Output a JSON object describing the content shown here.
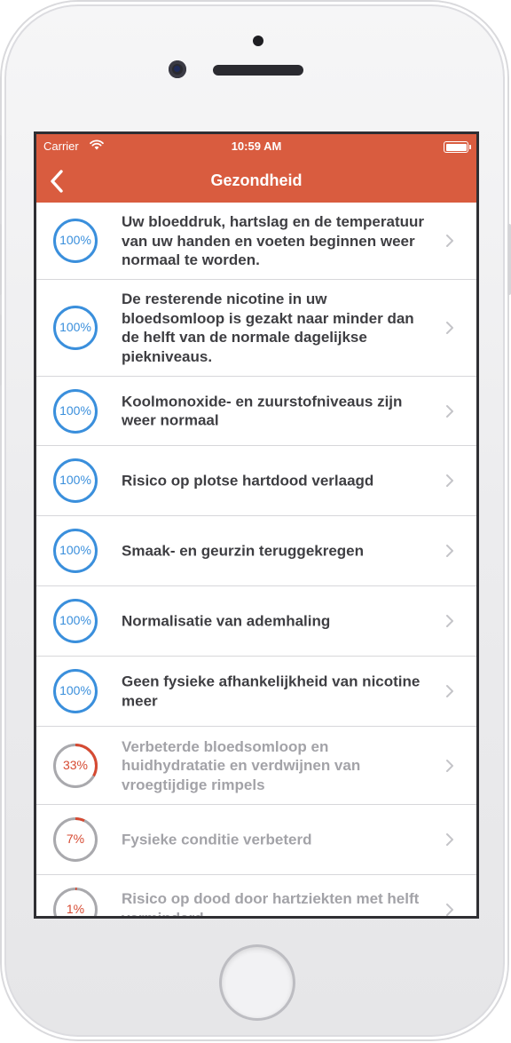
{
  "status_bar": {
    "carrier": "Carrier",
    "time": "10:59 AM"
  },
  "nav": {
    "title": "Gezondheid",
    "back_icon": "chevron-left-icon"
  },
  "colors": {
    "header": "#d95c3f",
    "ring_complete": "#3a8fdc",
    "ring_progress": "#d64a32",
    "ring_track": "#a9a9ad"
  },
  "items": [
    {
      "percent_label": "100%",
      "progress": 1.0,
      "text": "Uw bloeddruk, hartslag en de temperatuur van uw handen en voeten beginnen weer normaal te worden."
    },
    {
      "percent_label": "100%",
      "progress": 1.0,
      "text": "De resterende nicotine in uw bloedsomloop is gezakt naar minder dan de helft van de normale dagelijkse piekniveaus."
    },
    {
      "percent_label": "100%",
      "progress": 1.0,
      "text": "Koolmonoxide- en zuurstofniveaus zijn weer normaal"
    },
    {
      "percent_label": "100%",
      "progress": 1.0,
      "text": "Risico op plotse hartdood verlaagd"
    },
    {
      "percent_label": "100%",
      "progress": 1.0,
      "text": "Smaak- en geurzin teruggekregen"
    },
    {
      "percent_label": "100%",
      "progress": 1.0,
      "text": "Normalisatie van ademhaling"
    },
    {
      "percent_label": "100%",
      "progress": 1.0,
      "text": "Geen fysieke afhankelijkheid van nicotine meer"
    },
    {
      "percent_label": "33%",
      "progress": 0.33,
      "text": "Verbeterde bloedsomloop en huidhydratatie en verdwijnen van vroegtijdige rimpels"
    },
    {
      "percent_label": "7%",
      "progress": 0.07,
      "text": "Fysieke conditie verbeterd"
    },
    {
      "percent_label": "1%",
      "progress": 0.01,
      "text": "Risico op dood door hartziekten met helft verminderd"
    }
  ]
}
